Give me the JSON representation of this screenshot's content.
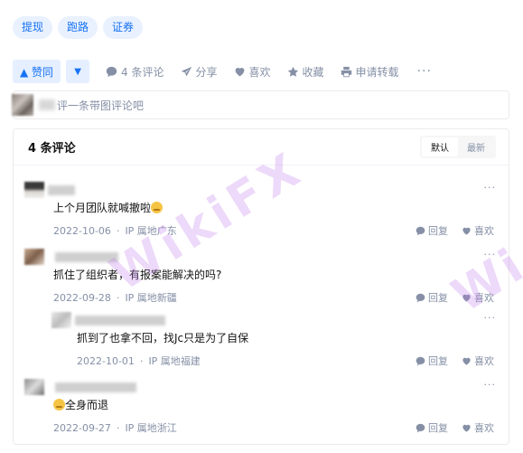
{
  "tags": [
    "提现",
    "跑路",
    "证券"
  ],
  "actions": {
    "vote_up": "▲ 赞同",
    "vote_down": "▼",
    "comments": "4 条评论",
    "share": "分享",
    "like": "喜欢",
    "collect": "收藏",
    "reprint": "申请转载",
    "more": "···"
  },
  "comment_input": {
    "placeholder": "评一条带图评论吧"
  },
  "comments_panel": {
    "title": "4 条评论",
    "sort_default": "默认",
    "sort_latest": "最新",
    "reply_label": "回复",
    "like_label": "喜欢",
    "more": "···",
    "ip_prefix": "IP 属地",
    "items": [
      {
        "text": "上个月团队就喊撤啦",
        "date": "2022-10-06",
        "location": "广东",
        "emoji_after": true
      },
      {
        "text": "抓住了组织者，有报案能解决的吗?",
        "date": "2022-09-28",
        "location": "新疆"
      },
      {
        "text": "抓到了也拿不回，找Jc只是为了自保",
        "date": "2022-10-01",
        "location": "福建"
      },
      {
        "text": "全身而退",
        "date": "2022-09-27",
        "location": "浙江",
        "emoji_before": true
      }
    ]
  },
  "watermark": "WikiFX",
  "watermark2": "Wi",
  "colors": {
    "accent": "#1772f6",
    "accent_bg": "#e5efff",
    "muted": "#8590a6",
    "watermark": "#be78eb"
  }
}
